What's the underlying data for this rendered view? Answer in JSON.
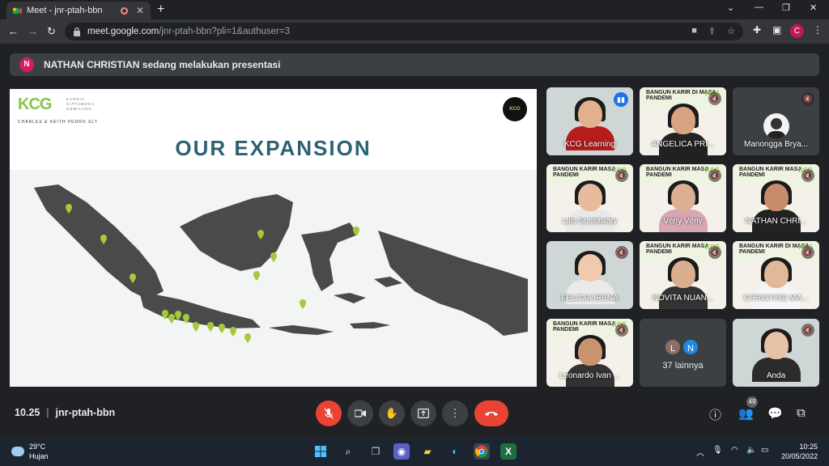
{
  "browser": {
    "tab_title": "Meet - jnr-ptah-bbn",
    "url_host": "meet.google.com",
    "url_path": "/jnr-ptah-bbn?pli=1&authuser=3",
    "profile_initial": "C"
  },
  "banner": {
    "avatar_initial": "N",
    "text": "NATHAN CHRISTIAN sedang melakukan presentasi"
  },
  "slide": {
    "logo": "KCG",
    "logo_sub": "KARNIA CIPTAMODA GEMILANG",
    "brands": "CHARLES & KEITH    PEDRO    SLT",
    "badge": "KCG",
    "title": "OUR EXPANSION",
    "map_color": "#4a4a4a",
    "pin_color": "#a6c83a"
  },
  "participants": [
    {
      "name": "KCG Learning",
      "state": "speaking"
    },
    {
      "name": "ANGELICA PRI...",
      "state": "muted",
      "banner": "BANGUN KARIR DI MASA PANDEMI"
    },
    {
      "name": "Manongga Brya...",
      "state": "muted"
    },
    {
      "name": "Lilis Susilawaty",
      "state": "muted",
      "banner": "BANGUN KARIR MASA PANDEMI"
    },
    {
      "name": "Vény Vény",
      "state": "muted",
      "banner": "BANGUN KARIR MASA PANDEMI"
    },
    {
      "name": "NATHAN CHRI...",
      "state": "muted",
      "banner": "BANGUN KARIR MASA PANDEMI"
    },
    {
      "name": "FELICIA IRENA",
      "state": "muted"
    },
    {
      "name": "NOVITA NUAN...",
      "state": "muted",
      "banner": "BANGUN KARIR MASA PANDEMI"
    },
    {
      "name": "CHRISTINE MA...",
      "state": "muted",
      "banner": "BANGUN KARIR DI MASA PANDEMI"
    },
    {
      "name": "Leonardo Ivan ...",
      "state": "muted",
      "banner": "BANGUN KARIR MASA PANDEMI"
    },
    {
      "name": "Anda",
      "state": "muted"
    }
  ],
  "others": {
    "initials": [
      "L",
      "N"
    ],
    "label": "37 lainnya"
  },
  "bottom": {
    "time": "10.25",
    "meeting_code": "jnr-ptah-bbn",
    "participant_count": "49"
  },
  "taskbar": {
    "temperature": "29°C",
    "condition": "Hujan",
    "time": "10:25",
    "date": "20/05/2022"
  }
}
